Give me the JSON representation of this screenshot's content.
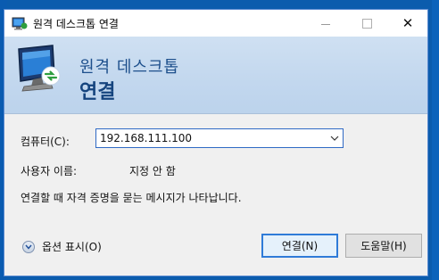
{
  "window": {
    "title": "원격 데스크톱 연결",
    "controls": {
      "minimize": "",
      "maximize": "",
      "close": "✕"
    }
  },
  "banner": {
    "line1": "원격 데스크톱",
    "line2": "연결"
  },
  "form": {
    "computer_label": "컴퓨터(C):",
    "computer_value": "192.168.111.100",
    "username_label": "사용자 이름:",
    "username_value": "지정 안 함",
    "note": "연결할 때 자격 증명을 묻는 메시지가 나타납니다."
  },
  "footer": {
    "options_label": "옵션 표시(O)",
    "connect_label": "연결(N)",
    "help_label": "도움말(H)"
  },
  "colors": {
    "desktop": "#0b5cad",
    "banner": "#c2d7ee",
    "accent": "#2f7bd8"
  }
}
